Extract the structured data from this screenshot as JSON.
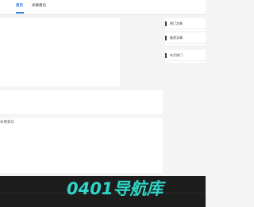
{
  "nav": {
    "items": [
      {
        "label": "首页",
        "active": true
      },
      {
        "label": "早樂資讯",
        "active": false
      }
    ]
  },
  "sidebar": {
    "cards": [
      {
        "title": "热门文章"
      },
      {
        "title": "推荐文章"
      },
      {
        "title": "本月热门"
      }
    ]
  },
  "section": {
    "label": "早樂資讯"
  },
  "watermark": {
    "text": "0401导航库",
    "color": "#2fd5c7"
  },
  "colors": {
    "accent": "#2f7bd9",
    "footer": "#1d1d1d"
  }
}
